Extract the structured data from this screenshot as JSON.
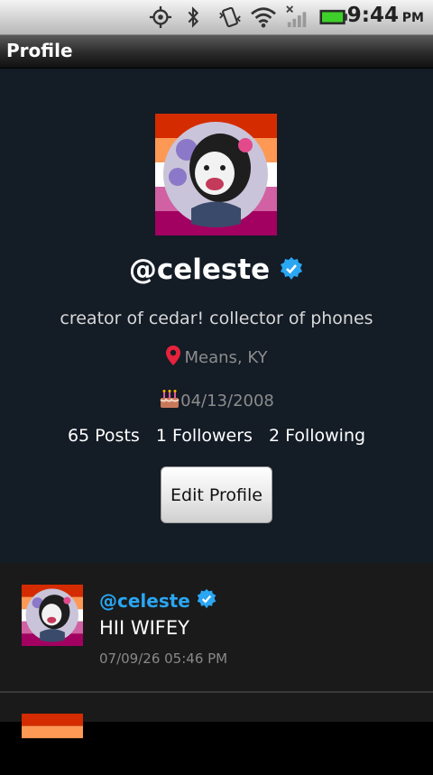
{
  "status_bar": {
    "time": "9:44",
    "ampm": "PM",
    "icons": [
      "gps-icon",
      "bluetooth-icon",
      "vibrate-icon",
      "wifi-icon",
      "signal-icon",
      "battery-icon"
    ]
  },
  "title_bar": {
    "title": "Profile"
  },
  "profile": {
    "username": "@celeste",
    "verified": true,
    "bio": "creator of cedar! collector of phones",
    "location": "Means, KY",
    "birthday": "04/13/2008",
    "stats": {
      "posts": "65 Posts",
      "followers": "1 Followers",
      "following": "2 Following"
    },
    "edit_button": "Edit Profile",
    "colors": {
      "background": "#141c26",
      "verified": "#2aa6f2",
      "pin": "#e8223b"
    }
  },
  "posts": [
    {
      "author": "@celeste",
      "content": "HII WIFEY",
      "time": "07/09/26 05:46 PM"
    }
  ]
}
